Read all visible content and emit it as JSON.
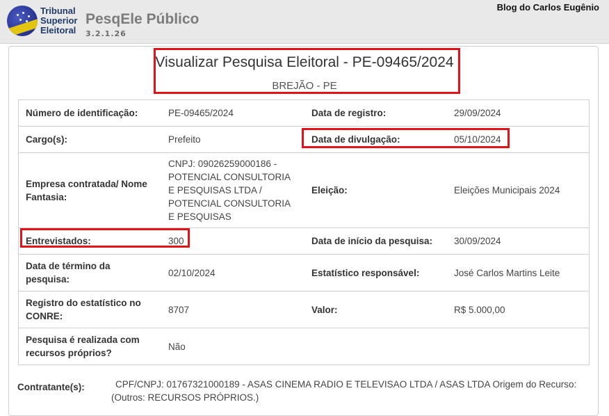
{
  "header": {
    "logo_lines": [
      "Tribunal",
      "Superior",
      "Eleitoral"
    ],
    "app_name": "PesqEle Público",
    "version": "3.2.1.26",
    "blog": "Blog do Carlos Eugênio"
  },
  "page": {
    "title": "Visualizar Pesquisa Eleitoral - PE-09465/2024",
    "subtitle": "BREJÃO - PE"
  },
  "rows": [
    {
      "l1": "Número de identificação:",
      "v1": "PE-09465/2024",
      "l2": "Data de registro:",
      "v2": "29/09/2024"
    },
    {
      "l1": "Cargo(s):",
      "v1": "Prefeito",
      "l2": "Data de divulgação:",
      "v2": "05/10/2024"
    },
    {
      "l1": "Empresa contratada/ Nome Fantasia:",
      "v1": "CNPJ: 09026259000186 - POTENCIAL CONSULTORIA E PESQUISAS LTDA / POTENCIAL CONSULTORIA E PESQUISAS",
      "l2": "Eleição:",
      "v2": "Eleições Municipais 2024"
    },
    {
      "l1": "Entrevistados:",
      "v1": "300",
      "l2": "Data de início da pesquisa:",
      "v2": "30/09/2024"
    },
    {
      "l1": "Data de término da pesquisa:",
      "v1": "02/10/2024",
      "l2": "Estatístico responsável:",
      "v2": "José Carlos Martins Leite"
    },
    {
      "l1": "Registro do estatístico no CONRE:",
      "v1": "8707",
      "l2": "Valor:",
      "v2": "R$ 5.000,00"
    },
    {
      "l1": "Pesquisa é realizada com recursos próprios?",
      "v1": "Não",
      "l2": "",
      "v2": ""
    }
  ],
  "contratante": {
    "label": "Contratante(s):",
    "line1": "CPF/CNPJ: 01767321000189 - ASAS CINEMA RADIO E TELEVISAO LTDA / ASAS LTDA Origem do Recurso:",
    "line2": "(Outros: RECURSOS PRÓPRIOS.)"
  }
}
